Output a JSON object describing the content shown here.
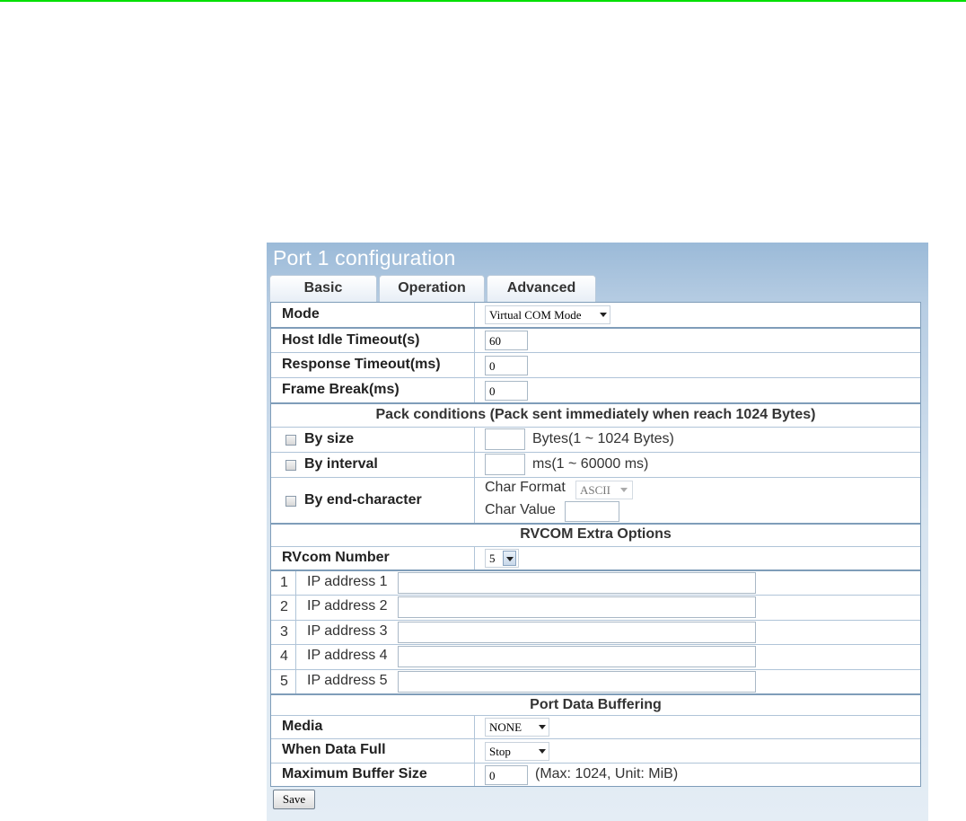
{
  "title": "Port 1 configuration",
  "tabs": [
    {
      "label": "Basic"
    },
    {
      "label": "Operation"
    },
    {
      "label": "Advanced"
    }
  ],
  "mode": {
    "label": "Mode",
    "value": "Virtual COM Mode"
  },
  "host_idle_timeout": {
    "label": "Host Idle Timeout(s)",
    "value": "60"
  },
  "response_timeout": {
    "label": "Response Timeout(ms)",
    "value": "0"
  },
  "frame_break": {
    "label": "Frame Break(ms)",
    "value": "0"
  },
  "pack": {
    "header": "Pack conditions (Pack sent immediately when reach 1024 Bytes)",
    "by_size": {
      "label": "By size",
      "value": "",
      "hint": "Bytes(1 ~ 1024 Bytes)"
    },
    "by_interval": {
      "label": "By interval",
      "value": "",
      "hint": "ms(1 ~ 60000 ms)"
    },
    "by_end_char": {
      "label": "By end-character",
      "char_format_label": "Char Format",
      "char_format_value": "ASCII",
      "char_value_label": "Char Value",
      "char_value": ""
    }
  },
  "rvcom": {
    "header": "RVCOM Extra Options",
    "number_label": "RVcom Number",
    "number_value": "5",
    "ips": [
      {
        "num": "1",
        "label": "IP address 1",
        "value": ""
      },
      {
        "num": "2",
        "label": "IP address 2",
        "value": ""
      },
      {
        "num": "3",
        "label": "IP address 3",
        "value": ""
      },
      {
        "num": "4",
        "label": "IP address 4",
        "value": ""
      },
      {
        "num": "5",
        "label": "IP address 5",
        "value": ""
      }
    ]
  },
  "buffering": {
    "header": "Port Data Buffering",
    "media_label": "Media",
    "media_value": "NONE",
    "full_label": "When Data Full",
    "full_value": "Stop",
    "max_label": "Maximum Buffer Size",
    "max_value": "0",
    "max_hint": "(Max: 1024, Unit: MiB)"
  },
  "save_label": "Save",
  "colors": {
    "panel": "#9bbad8",
    "border": "#7f9db9",
    "topline": "#00e000"
  }
}
